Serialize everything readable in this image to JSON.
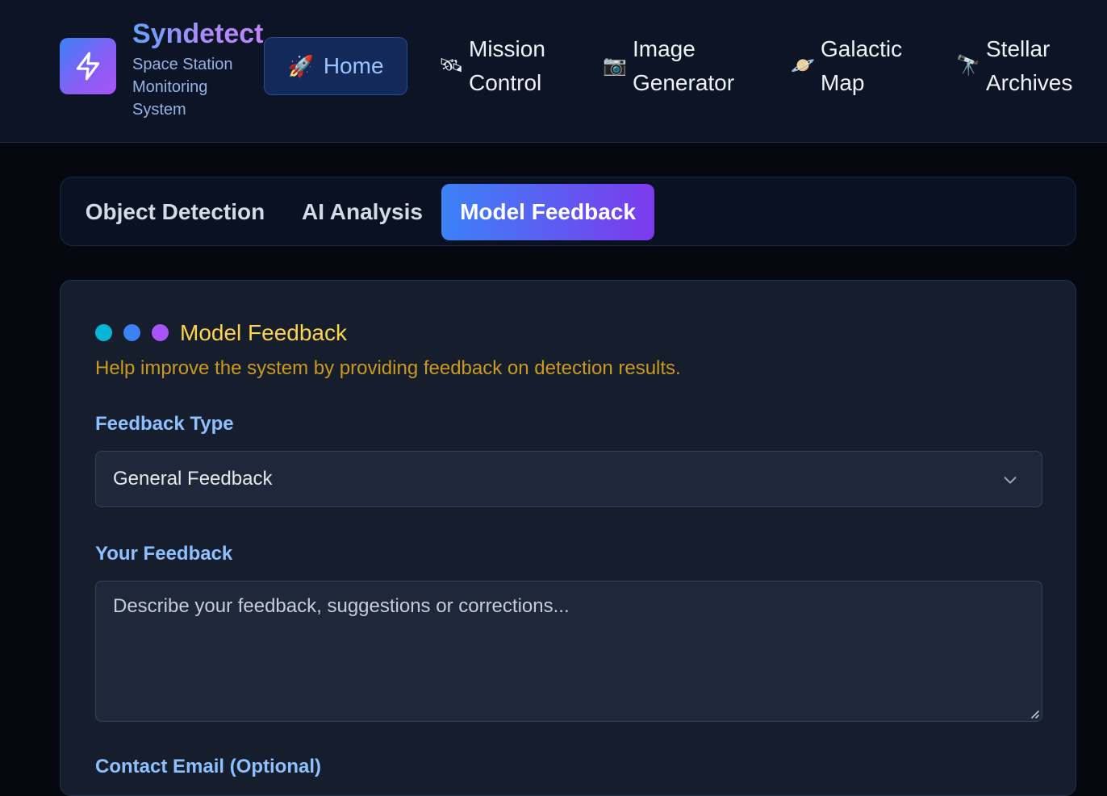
{
  "brand": {
    "name": "Syndetect",
    "subtitle": "Space Station Monitoring System",
    "logo_icon": "lightning-bolt-icon"
  },
  "nav": {
    "home": {
      "label": "Home",
      "icon": "rocket-icon",
      "active": true
    },
    "items": [
      {
        "label": "Mission\nControl",
        "icon": "satellite-icon",
        "glyph": "🛰"
      },
      {
        "label": "Image\nGenerator",
        "icon": "camera-icon",
        "glyph": "📷"
      },
      {
        "label": "Galactic\nMap",
        "icon": "ringed-planet-icon",
        "glyph": "🪐"
      },
      {
        "label": "Stellar\nArchives",
        "icon": "telescope-icon",
        "glyph": "🔭"
      }
    ]
  },
  "tabs": [
    {
      "label": "Object Detection",
      "active": false
    },
    {
      "label": "AI Analysis",
      "active": false
    },
    {
      "label": "Model Feedback",
      "active": true
    }
  ],
  "feedback": {
    "title": "Model Feedback",
    "description": "Help improve the system by providing feedback on detection results.",
    "dot_colors": [
      "#06b6d4",
      "#3b82f6",
      "#a855f7"
    ],
    "type_label": "Feedback Type",
    "type_value": "General Feedback",
    "feedback_label": "Your Feedback",
    "feedback_placeholder": "Describe your feedback, suggestions or corrections...",
    "email_label": "Contact Email (Optional)"
  },
  "colors": {
    "accent_blue": "#3b82f6",
    "accent_purple": "#7c3aed",
    "title_yellow": "#fcd34d",
    "label_blue": "#8cc0ff"
  }
}
